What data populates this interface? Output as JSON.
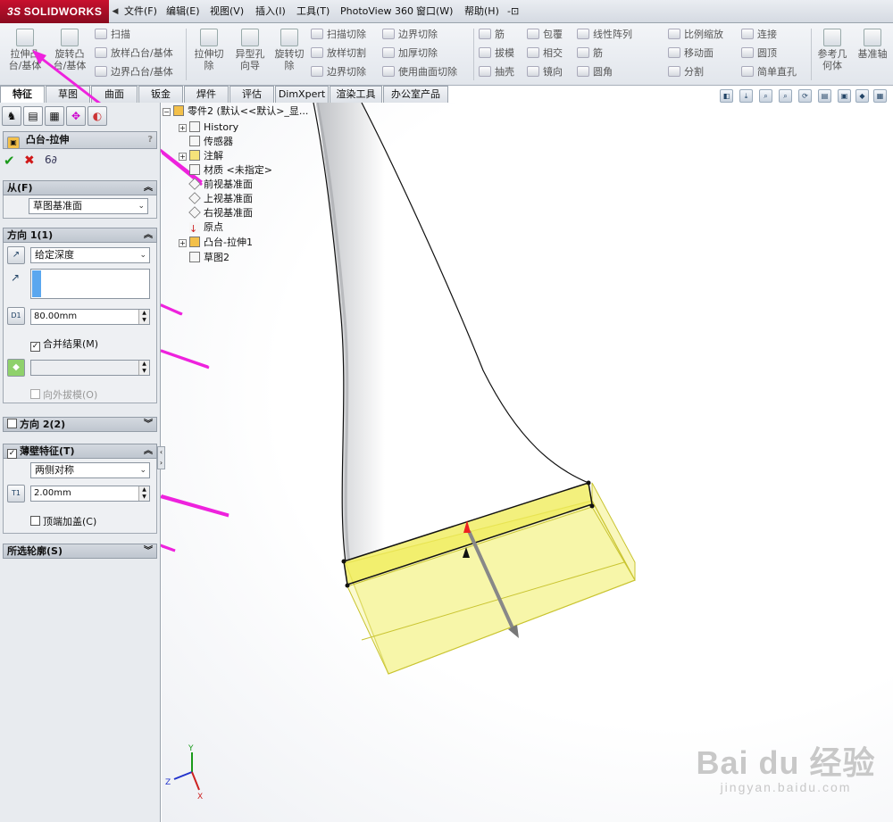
{
  "app": {
    "logo": "SOLIDWORKS",
    "logo_prefix": "3S"
  },
  "menu": [
    "文件(F)",
    "编辑(E)",
    "视图(V)",
    "插入(I)",
    "工具(T)",
    "PhotoView 360",
    "窗口(W)",
    "帮助(H)",
    "-⊡"
  ],
  "toolbar": {
    "extrude_boss": "拉伸凸\n台/基体",
    "revolve_boss": "旋转凸\n台/基体",
    "sweep": "扫描",
    "loft_boss": "放样凸台/基体",
    "boundary_boss": "边界凸台/基体",
    "extrude_cut": "拉伸切\n除",
    "hole_wizard": "异型孔\n向导",
    "revolve_cut": "旋转切\n除",
    "sweep_cut": "扫描切除",
    "loft_cut": "放样切割",
    "boundary_cut_a": "边界切除",
    "boundary_cut_b": "边界切除",
    "thicken_cut": "加厚切除",
    "surface_cut": "使用曲面切除",
    "rib": "筋",
    "draft": "拔模",
    "shell": "抽壳",
    "wrap": "包覆",
    "intersect": "相交",
    "mirror": "镜向",
    "linear_pattern": "线性阵列",
    "rib2": "筋",
    "fillet": "圆角",
    "scale": "比例缩放",
    "move_face": "移动面",
    "split": "分割",
    "connect": "连接",
    "dome": "圆顶",
    "simple_hole": "简单直孔",
    "ref_geometry": "参考几\n何体",
    "ref_axis": "基准轴"
  },
  "tabs": [
    "特征",
    "草图",
    "曲面",
    "钣金",
    "焊件",
    "评估",
    "DimXpert",
    "渲染工具",
    "办公室产品"
  ],
  "panel": {
    "title": "凸台-拉伸",
    "help": "?",
    "ok": "✔",
    "cancel": "✖",
    "preview": "6∂",
    "from": {
      "header": "从(F)",
      "value": "草图基准面"
    },
    "dir1": {
      "header": "方向 1(1)",
      "end_condition": "给定深度",
      "depth": "80.00mm",
      "merge_label": "合并结果(M)",
      "merge_checked": true,
      "draft_label": "向外拔模(O)"
    },
    "dir2": {
      "header": "方向 2(2)"
    },
    "thin": {
      "header": "薄壁特征(T)",
      "checked": true,
      "type": "两侧对称",
      "thickness": "2.00mm",
      "cap_label": "顶端加盖(C)"
    },
    "contours": {
      "header": "所选轮廓(S)"
    }
  },
  "tree": {
    "root": "零件2 (默认<<默认>_显...",
    "items": [
      "History",
      "传感器",
      "注解",
      "材质 <未指定>",
      "前视基准面",
      "上视基准面",
      "右视基准面",
      "原点",
      "凸台-拉伸1",
      "草图2"
    ]
  },
  "watermark": {
    "main": "Bai du 经验",
    "sub": "jingyan.baidu.com"
  },
  "colors": {
    "accent_arrow": "#ee22dd",
    "preview_fill": "#f3f07a",
    "preview_edge": "#111111",
    "logo_red": "#c8102e"
  }
}
